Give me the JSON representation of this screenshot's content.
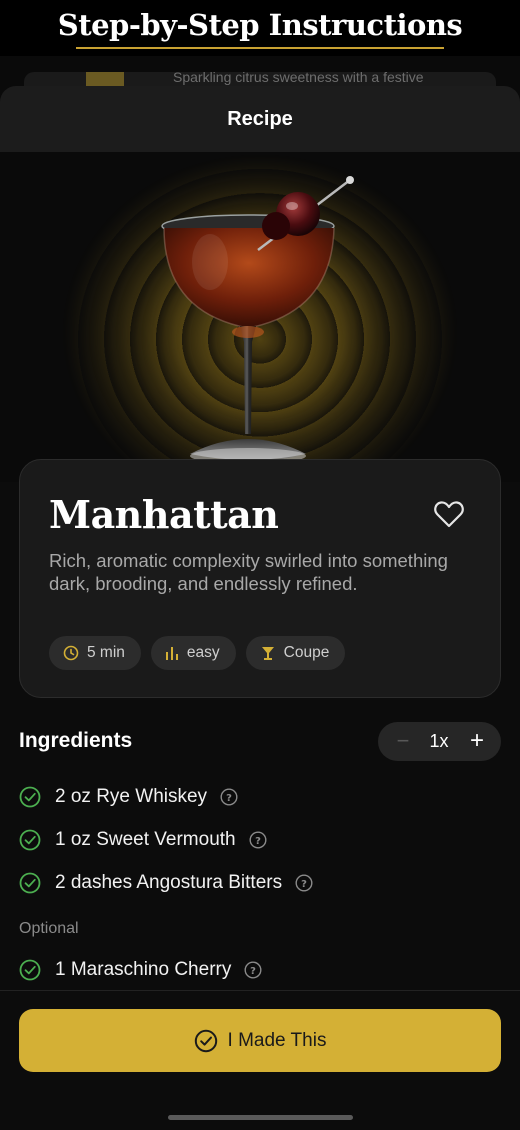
{
  "banner": {
    "title": "Step-by-Step Instructions"
  },
  "background_card": {
    "subtitle": "Sparkling citrus sweetness with a festive"
  },
  "sheet": {
    "title": "Recipe"
  },
  "drink": {
    "name": "Manhattan",
    "description": "Rich, aromatic complexity swirled into something dark, brooding, and endlessly refined.",
    "chips": [
      {
        "icon": "clock-icon",
        "label": "5 min"
      },
      {
        "icon": "bar-chart-icon",
        "label": "easy"
      },
      {
        "icon": "coupe-glass-icon",
        "label": "Coupe"
      }
    ]
  },
  "ingredients": {
    "heading": "Ingredients",
    "servings": {
      "minus": "−",
      "value": "1x",
      "plus": "+"
    },
    "items": [
      {
        "text": "2 oz Rye Whiskey"
      },
      {
        "text": "1 oz Sweet Vermouth"
      },
      {
        "text": "2 dashes Angostura Bitters"
      }
    ],
    "optional_label": "Optional",
    "optional_items": [
      {
        "text": "1 Maraschino Cherry"
      }
    ]
  },
  "actions": {
    "made_this": "I Made This"
  },
  "colors": {
    "accent": "#d4b035",
    "check": "#4caf50",
    "background": "#0c0c0c",
    "card": "#1a1a1a"
  }
}
